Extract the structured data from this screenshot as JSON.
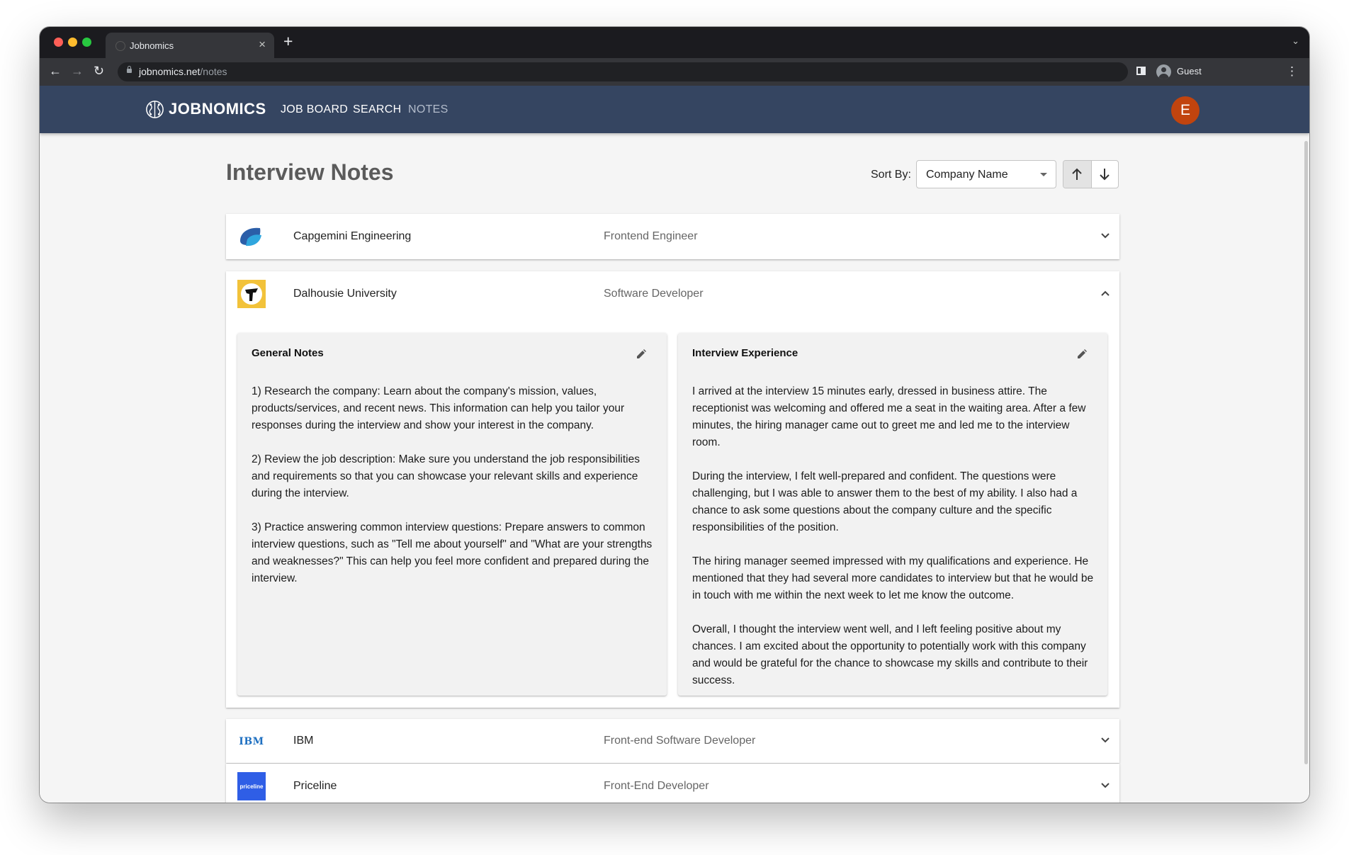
{
  "browser": {
    "tab_title": "Jobnomics",
    "url_host": "jobnomics.net",
    "url_path": "/notes",
    "profile_label": "Guest"
  },
  "app": {
    "brand": "JOBNOMICS",
    "nav": [
      "JOB BOARD",
      "SEARCH",
      "NOTES"
    ],
    "user_initial": "E",
    "accent_color": "#354561",
    "avatar_color": "#c1440e"
  },
  "page": {
    "title": "Interview Notes",
    "sort_label": "Sort By:",
    "sort_value": "Company Name",
    "sort_direction": "ascending"
  },
  "notes": [
    {
      "company": "Capgemini Engineering",
      "role": "Frontend Engineer",
      "expanded": false
    },
    {
      "company": "Dalhousie University",
      "role": "Software Developer",
      "expanded": true,
      "general_title": "General Notes",
      "general": [
        "1) Research the company: Learn about the company's mission, values, products/services, and recent news. This information can help you tailor your responses during the interview and show your interest in the company.",
        "2) Review the job description: Make sure you understand the job responsibilities and requirements so that you can showcase your relevant skills and experience during the interview.",
        "3) Practice answering common interview questions: Prepare answers to common interview questions, such as \"Tell me about yourself\" and \"What are your strengths and weaknesses?\" This can help you feel more confident and prepared during the interview."
      ],
      "experience_title": "Interview Experience",
      "experience": [
        "I arrived at the interview 15 minutes early, dressed in business attire. The receptionist was welcoming and offered me a seat in the waiting area. After a few minutes, the hiring manager came out to greet me and led me to the interview room.",
        "During the interview, I felt well-prepared and confident. The questions were challenging, but I was able to answer them to the best of my ability. I also had a chance to ask some questions about the company culture and the specific responsibilities of the position.",
        "The hiring manager seemed impressed with my qualifications and experience. He mentioned that they had several more candidates to interview but that he would be in touch with me within the next week to let me know the outcome.",
        "Overall, I thought the interview went well, and I left feeling positive about my chances. I am excited about the opportunity to potentially work with this company and would be grateful for the chance to showcase my skills and contribute to their success."
      ]
    },
    {
      "company": "IBM",
      "role": "Front-end Software Developer",
      "expanded": false,
      "logo_text": "IBM"
    },
    {
      "company": "Priceline",
      "role": "Front-End Developer",
      "expanded": false,
      "logo_text": "priceline"
    }
  ]
}
